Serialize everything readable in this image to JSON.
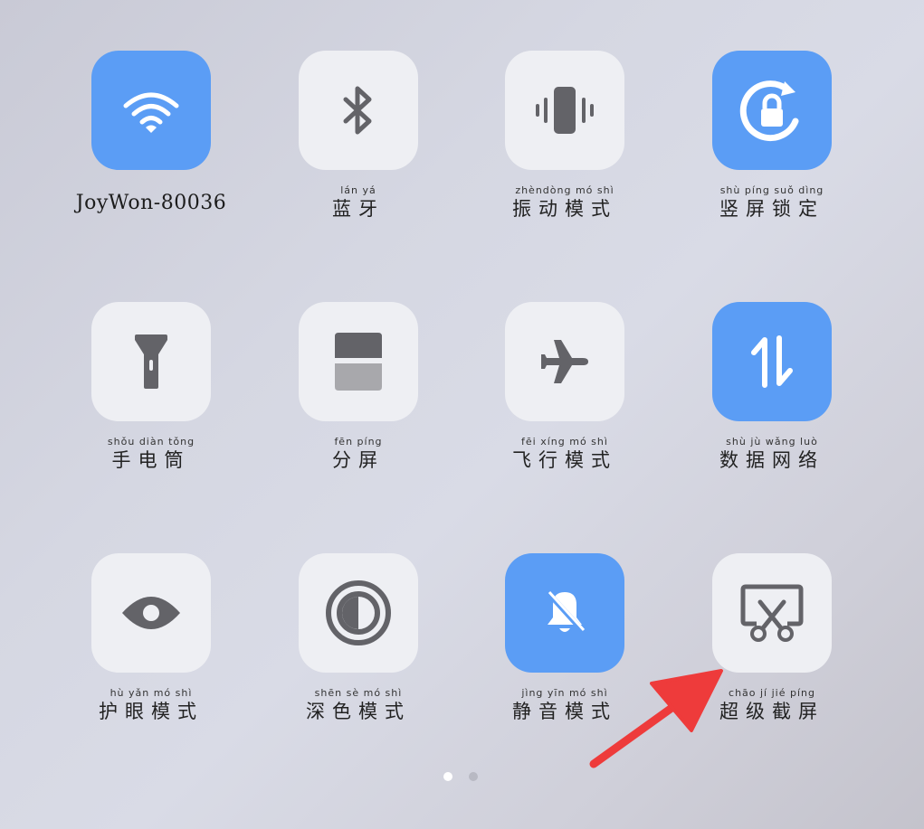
{
  "tiles": [
    {
      "id": "wifi",
      "text": "JoyWon-80036",
      "pinyin": "",
      "active": true,
      "icon": "wifi-icon"
    },
    {
      "id": "bluetooth",
      "text": "蓝牙",
      "pinyin": "lán yá",
      "active": false,
      "icon": "bluetooth-icon"
    },
    {
      "id": "vibrate",
      "text": "振动模式",
      "pinyin": "zhèndòng mó shì",
      "active": false,
      "icon": "vibrate-icon"
    },
    {
      "id": "rotation-lock",
      "text": "竖屏锁定",
      "pinyin": "shù píng suǒ dìng",
      "active": true,
      "icon": "rotation-lock-icon"
    },
    {
      "id": "flashlight",
      "text": "手电筒",
      "pinyin": "shǒu diàn tǒng",
      "active": false,
      "icon": "flashlight-icon"
    },
    {
      "id": "split-screen",
      "text": "分屏",
      "pinyin": "fēn píng",
      "active": false,
      "icon": "split-screen-icon"
    },
    {
      "id": "airplane",
      "text": "飞行模式",
      "pinyin": "fēi xíng mó shì",
      "active": false,
      "icon": "airplane-icon"
    },
    {
      "id": "mobile-data",
      "text": "数据网络",
      "pinyin": "shù jù wǎng luò",
      "active": true,
      "icon": "mobile-data-icon"
    },
    {
      "id": "eye-care",
      "text": "护眼模式",
      "pinyin": "hù yǎn mó shì",
      "active": false,
      "icon": "eye-icon"
    },
    {
      "id": "dark-mode",
      "text": "深色模式",
      "pinyin": "shēn sè mó shì",
      "active": false,
      "icon": "dark-mode-icon"
    },
    {
      "id": "silent",
      "text": "静音模式",
      "pinyin": "jìng yīn mó shì",
      "active": true,
      "icon": "bell-off-icon"
    },
    {
      "id": "super-screenshot",
      "text": "超级截屏",
      "pinyin": "chāo jí jié píng",
      "active": false,
      "icon": "screenshot-scissors-icon"
    }
  ],
  "pager": {
    "current": 1,
    "total": 2
  },
  "annotation": {
    "type": "arrow",
    "color": "#ee3b3b",
    "points_to": "super-screenshot"
  },
  "colors": {
    "active_tile": "#5b9df5",
    "inactive_tile": "#eeeff3",
    "icon_gray": "#636368"
  }
}
